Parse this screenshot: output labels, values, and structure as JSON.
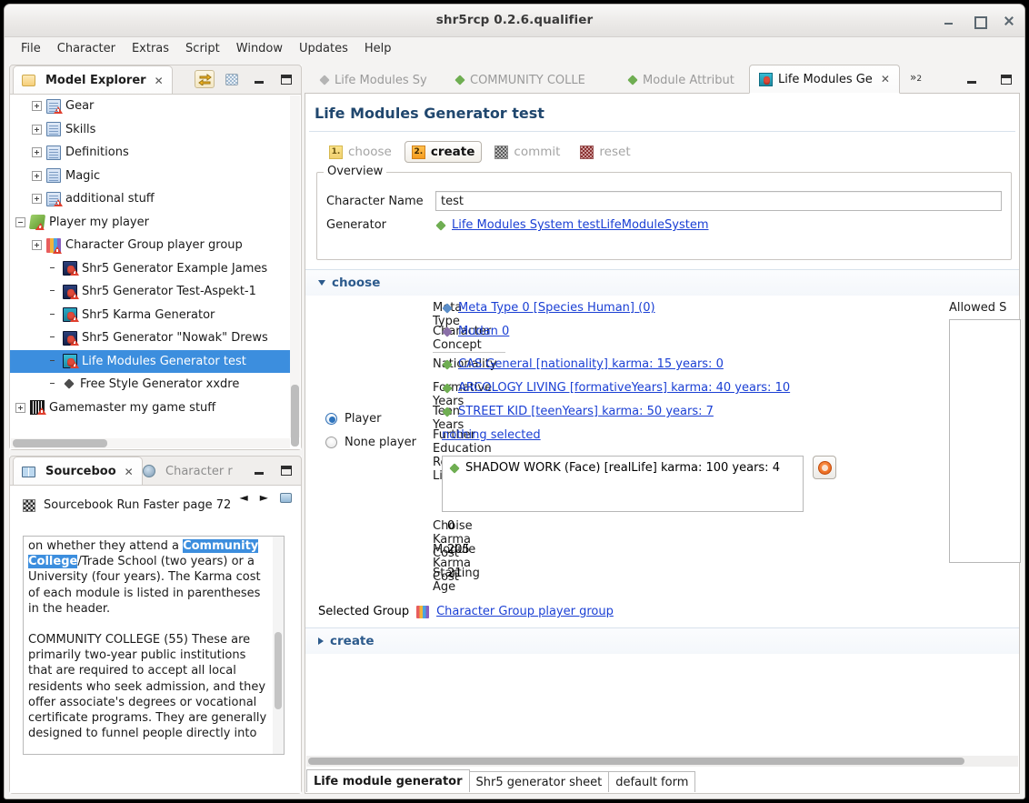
{
  "window": {
    "title": "shr5rcp 0.2.6.qualifier",
    "controls": {
      "minimize": "minimize",
      "maximize": "maximize",
      "close": "close"
    }
  },
  "menubar": {
    "items": [
      "File",
      "Character",
      "Extras",
      "Script",
      "Window",
      "Updates",
      "Help"
    ]
  },
  "model_explorer": {
    "tab_label": "Model Explorer",
    "tab_close": "✕",
    "tree": [
      {
        "label": "Gear",
        "indent": 2,
        "expander": "plus",
        "icon": "table-warn-icon"
      },
      {
        "label": "Skills",
        "indent": 2,
        "expander": "plus",
        "icon": "table-icon"
      },
      {
        "label": "Definitions",
        "indent": 2,
        "expander": "plus",
        "icon": "table-icon"
      },
      {
        "label": "Magic",
        "indent": 2,
        "expander": "plus",
        "icon": "table-icon"
      },
      {
        "label": "additional stuff",
        "indent": 2,
        "expander": "plus",
        "icon": "table-warn-icon"
      },
      {
        "label": "Player my player",
        "indent": 1,
        "expander": "minus",
        "icon": "player-icon"
      },
      {
        "label": "Character Group player group",
        "indent": 2,
        "expander": "plus",
        "icon": "group-icon"
      },
      {
        "label": "Shr5 Generator Example James",
        "indent": 3,
        "expander": "none",
        "icon": "generator-icon"
      },
      {
        "label": "Shr5 Generator Test-Aspekt-1",
        "indent": 3,
        "expander": "none",
        "icon": "generator-icon"
      },
      {
        "label": "Shr5 Karma Generator",
        "indent": 3,
        "expander": "none",
        "icon": "karma-generator-icon"
      },
      {
        "label": "Shr5 Generator \"Nowak\" Drews",
        "indent": 3,
        "expander": "none",
        "icon": "generator-icon"
      },
      {
        "label": "Life Modules Generator test",
        "indent": 3,
        "expander": "none",
        "icon": "life-generator-icon",
        "selected": true
      },
      {
        "label": "Free Style Generator xxdre",
        "indent": 3,
        "expander": "none",
        "icon": "diamond-icon"
      },
      {
        "label": "Gamemaster my game stuff",
        "indent": 1,
        "expander": "plus",
        "icon": "gamemaster-icon"
      }
    ]
  },
  "sourcebook": {
    "tab_label": "Sourceboo",
    "tab_close": "✕",
    "other_tab_label": "Character r",
    "nav": {
      "back": "◄",
      "forward": "►",
      "link": "link-icon"
    },
    "header": "Sourcebook Run Faster page 72",
    "paragraphs": [
      {
        "pre": "on whether they attend a ",
        "highlight": "Community College",
        "post": "/Trade School (two years) or a University (four  years). The Karma cost of each module is listed in parentheses in the header."
      },
      {
        "pre": "COMMUNITY COLLEGE (55) These are primarily two-year public institutions that are  required to accept all local residents who seek admission, and they offer associate's degrees or vocational certificate programs. They are generally designed to  funnel people directly into",
        "highlight": "",
        "post": ""
      }
    ]
  },
  "editor": {
    "tabs": [
      {
        "label": "Life Modules Sy",
        "active": false,
        "icon": "diamond-grey-icon"
      },
      {
        "label": "COMMUNITY COLLE",
        "active": false,
        "icon": "diamond-green-icon"
      },
      {
        "label": "Module Attribut",
        "active": false,
        "icon": "diamond-green-icon"
      },
      {
        "label": "Life Modules Ge",
        "active": true,
        "icon": "life-generator-icon",
        "close": "✕"
      }
    ],
    "overflow_label": "»",
    "overflow_count": "2",
    "form_title": "Life Modules Generator test",
    "form_toolbar": [
      {
        "num": "1.",
        "label": "choose",
        "state": "dim",
        "icon_style": "y"
      },
      {
        "num": "2.",
        "label": "create",
        "state": "selected",
        "icon_style": "o"
      },
      {
        "num": "",
        "label": "commit",
        "state": "dim",
        "icon_style": "g"
      },
      {
        "num": "",
        "label": "reset",
        "state": "dim",
        "icon_style": "r"
      }
    ],
    "overview": {
      "group_label": "Overview",
      "character_name_label": "Character Name",
      "character_name_value": "test",
      "character_name_placeholder": "",
      "generator_label": "Generator",
      "generator_link": "Life Modules System testLifeModuleSystem"
    },
    "choose_section": {
      "header": "choose",
      "expanded": true,
      "radios": [
        {
          "label": "Player",
          "checked": true
        },
        {
          "label": "None player",
          "checked": false
        }
      ],
      "fields": [
        {
          "label": "Meta Type",
          "value": "Meta Type 0 [Species Human] (0)",
          "link": true,
          "icon": "diamond-blue-icon"
        },
        {
          "label": "Character Concept",
          "value": "Mudan 0",
          "link": true,
          "icon": "diamond-purple-icon"
        },
        {
          "label": "Nationality",
          "value": "CAS General [nationality] karma: 15 years: 0",
          "link": true,
          "icon": "diamond-green-icon"
        },
        {
          "label": "Formative Years",
          "value": "ARCOLOGY LIVING [formativeYears] karma: 40 years: 10",
          "link": true,
          "icon": "diamond-green-icon"
        },
        {
          "label": "Teen Years",
          "value": "STREET KID [teenYears] karma: 50 years: 7",
          "link": true,
          "icon": "diamond-green-icon"
        },
        {
          "label": "Further Education",
          "value": "nothing selected",
          "link": true,
          "icon": "none"
        }
      ],
      "real_life": {
        "label": "Real Life",
        "entry": "SHADOW WORK (Face) [realLife] karma: 100 years: 4",
        "button": "refresh-button"
      },
      "stats": [
        {
          "label": "Choise Karma Cost",
          "value": "0"
        },
        {
          "label": "Module Karma Cost",
          "value": "205"
        },
        {
          "label": "Starting Age",
          "value": "21"
        }
      ],
      "allowed_label": "Allowed S",
      "selected_group_label": "Selected Group",
      "selected_group_link": "Character Group player group"
    },
    "create_section": {
      "header": "create",
      "expanded": false
    },
    "form_tabs": [
      {
        "label": "Life module generator",
        "active": true
      },
      {
        "label": "Shr5 generator sheet",
        "active": false
      },
      {
        "label": "default form",
        "active": false
      }
    ]
  },
  "colors": {
    "selection_blue": "#3c8ede",
    "link_blue": "#1a3fd4",
    "section_header_blue": "#2c5a8c",
    "title_blue": "#20476e",
    "accent_orange": "#f59c1f"
  }
}
